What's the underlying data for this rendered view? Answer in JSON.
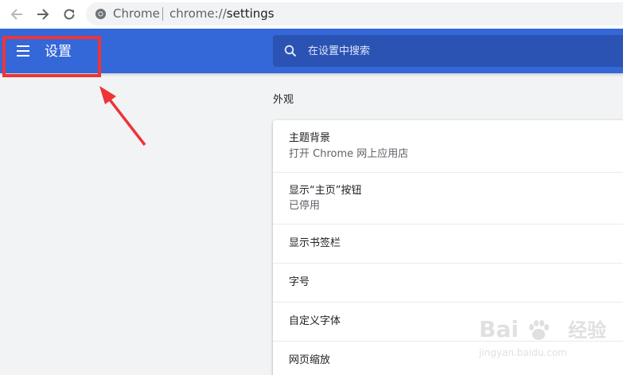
{
  "browser": {
    "site_name": "Chrome",
    "url_scheme": "chrome://",
    "url_path": "settings"
  },
  "header": {
    "title": "设置",
    "search_placeholder": "在设置中搜索"
  },
  "appearance": {
    "section_title": "外观",
    "rows": [
      {
        "title": "主题背景",
        "subtitle": "打开 Chrome 网上应用店"
      },
      {
        "title": "显示“主页”按钮",
        "subtitle": "已停用"
      },
      {
        "title": "显示书签栏"
      },
      {
        "title": "字号"
      },
      {
        "title": "自定义字体"
      },
      {
        "title": "网页缩放"
      }
    ]
  },
  "watermark": {
    "brand": "Bai",
    "brand_suffix": "经验",
    "url": "jingyan.baidu.com"
  },
  "colors": {
    "header_blue": "#3467d8",
    "search_bg": "#2a53b4",
    "highlight_red": "#ee3437"
  }
}
